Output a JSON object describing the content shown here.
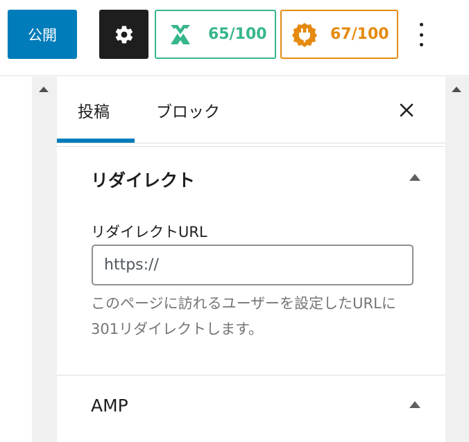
{
  "toolbar": {
    "publish_label": "公開",
    "seo_score": "65/100",
    "readability_score": "67/100"
  },
  "tabs": {
    "post": "投稿",
    "block": "ブロック"
  },
  "redirect": {
    "title": "リダイレクト",
    "field_label": "リダイレクトURL",
    "url_value": "https://",
    "help": "このページに訪れるユーザーを設定したURLに301リダイレクトします。"
  },
  "amp": {
    "title": "AMP"
  },
  "colors": {
    "primary": "#007cba",
    "seo": "#36b68a",
    "readability": "#e58a10"
  }
}
